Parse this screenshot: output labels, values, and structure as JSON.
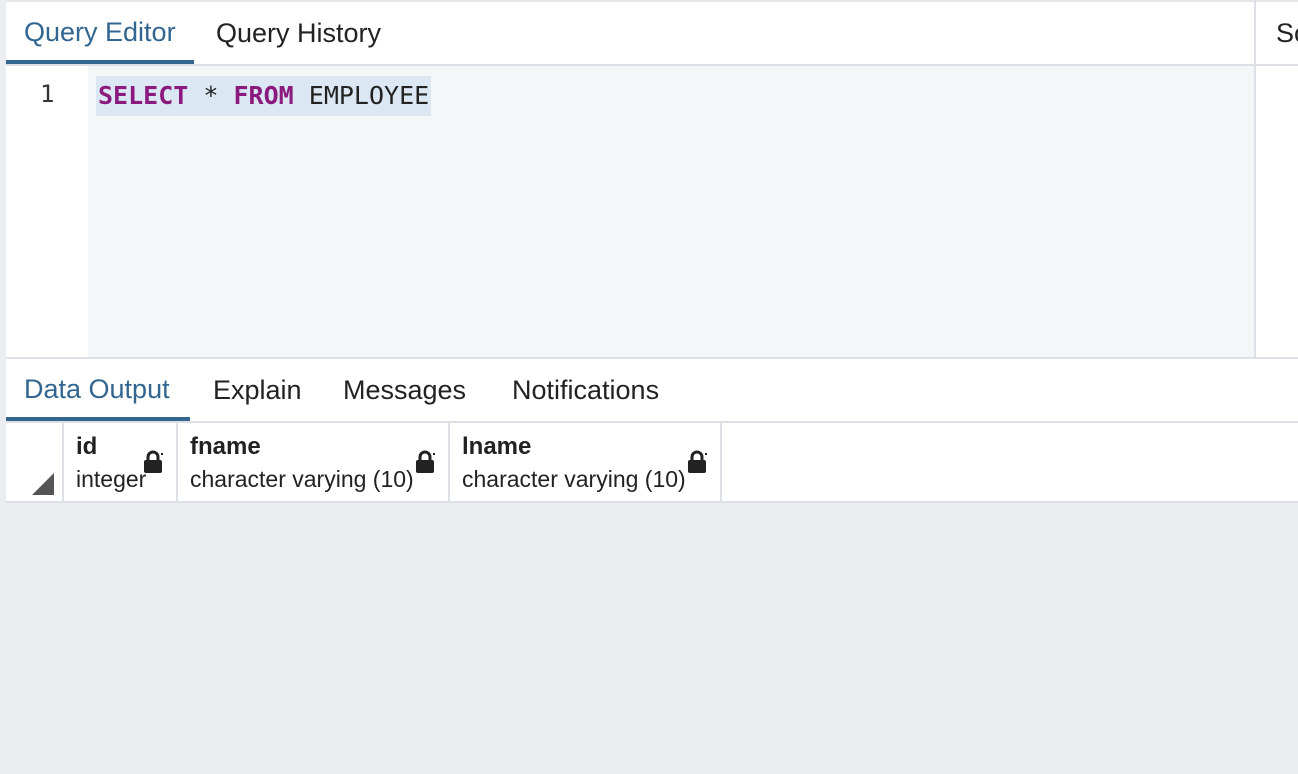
{
  "editor_tabs": [
    {
      "label": "Query Editor",
      "active": true
    },
    {
      "label": "Query History",
      "active": false
    }
  ],
  "side_panel": {
    "tab_label": "Scratch Pad"
  },
  "editor": {
    "line_numbers": [
      "1"
    ],
    "code": {
      "keyword1": "SELECT",
      "operator": "*",
      "keyword2": "FROM",
      "table": "EMPLOYEE"
    }
  },
  "output_tabs": [
    {
      "label": "Data Output",
      "active": true
    },
    {
      "label": "Explain",
      "active": false
    },
    {
      "label": "Messages",
      "active": false
    },
    {
      "label": "Notifications",
      "active": false
    }
  ],
  "columns": [
    {
      "name": "id",
      "type": "integer"
    },
    {
      "name": "fname",
      "type": "character varying (10)"
    },
    {
      "name": "lname",
      "type": "character varying (10)"
    }
  ],
  "icons": {
    "lock": "lock-icon",
    "sort_corner": "select-all-triangle-icon"
  },
  "colors": {
    "accent": "#326690",
    "keyword": "#8b1a7e",
    "selection": "#dbe8f3",
    "empty_grid": "#ebedf1"
  }
}
